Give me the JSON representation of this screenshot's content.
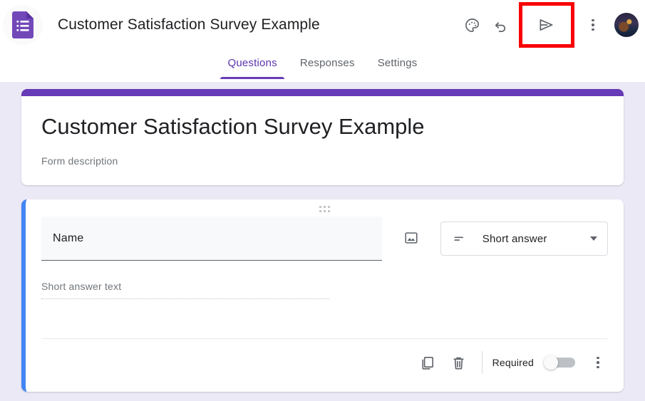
{
  "header": {
    "logo_icon": "google-forms-icon",
    "doc_title": "Customer Satisfaction Survey Example",
    "actions": [
      {
        "name": "theme-palette-icon",
        "label": "Customize theme"
      },
      {
        "name": "undo-icon",
        "label": "Undo"
      },
      {
        "name": "send-icon",
        "label": "Send"
      },
      {
        "name": "more-options-icon",
        "label": "More options"
      }
    ],
    "avatar_label": "Account avatar",
    "highlight_color": "#f80000",
    "highlighted_action": "send-icon"
  },
  "tabs": {
    "items": [
      {
        "label": "Questions",
        "active": true
      },
      {
        "label": "Responses",
        "active": false
      },
      {
        "label": "Settings",
        "active": false
      }
    ],
    "active_color": "#673ab7"
  },
  "form": {
    "accent_bar_color": "#673ab7",
    "title": "Customer Satisfaction Survey Example",
    "description": "Form description"
  },
  "question": {
    "accent_border_color": "#4285f4",
    "drag_handle_icon": "drag-handle-icon",
    "title": "Name",
    "image_icon": "add-image-icon",
    "type_icon": "short-answer-icon",
    "type_value": "Short answer",
    "dropdown_icon": "chevron-down-icon",
    "answer_placeholder": "Short answer text",
    "footer": {
      "duplicate_icon": "duplicate-icon",
      "delete_icon": "trash-icon",
      "required_label": "Required",
      "required_on": false,
      "more_icon": "more-options-icon"
    }
  },
  "colors": {
    "page_background": "#ece9f6",
    "card_background": "#ffffff",
    "purple": "#673ab7",
    "blue": "#4285f4",
    "text_primary": "#202124",
    "text_secondary": "#70757a"
  }
}
